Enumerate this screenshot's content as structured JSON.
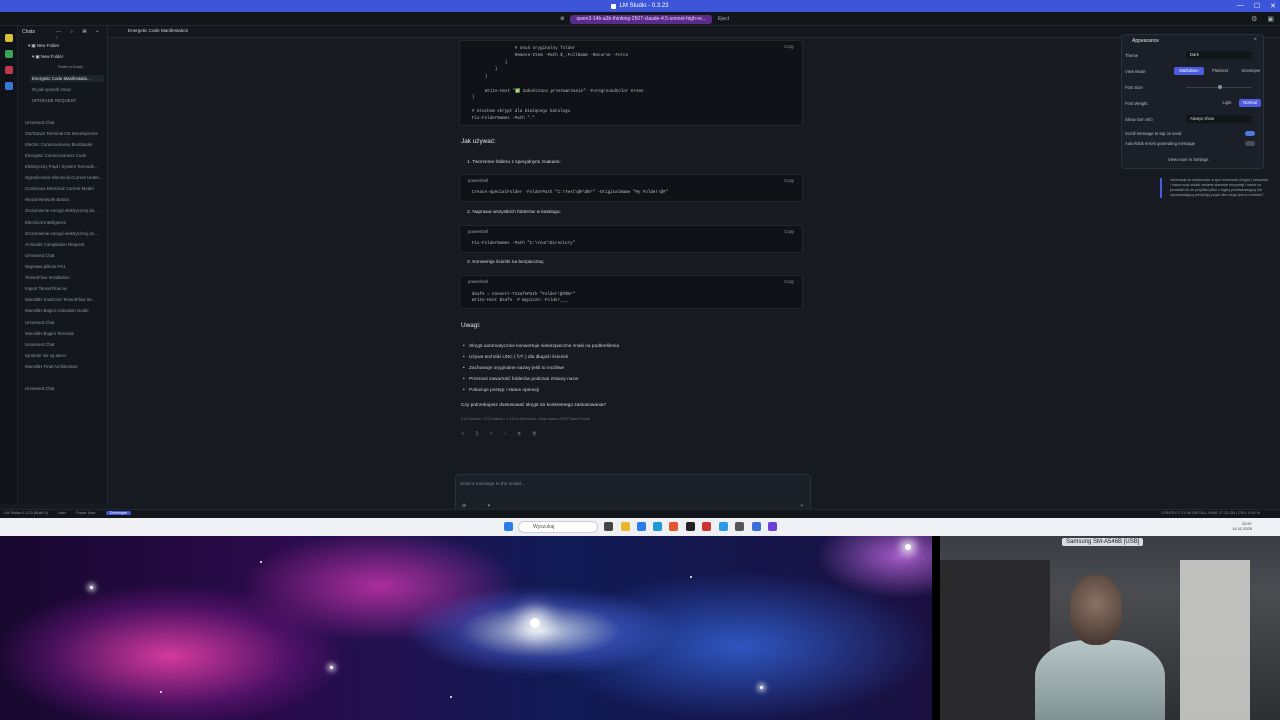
{
  "window": {
    "title": "LM Studio - 0.3.23"
  },
  "topbar": {
    "model": "qwen3-14b-a3b-thinking-2507-claude-4.5-sonnet-high-re...",
    "eject": "Eject"
  },
  "sidebar": {
    "header": "Chats",
    "folder": "New Folder",
    "subfolder": "New Folder",
    "empty_note": "Folder is Empty",
    "folder_items": [
      "Energetic Code Manifestatio...",
      "W jaki sposób zmaz",
      "UPGRADE REQUEST"
    ],
    "items": [
      "Unnamed Chat",
      "OS/Gatuzi Terminal OS Development",
      "Electric Consciousness Bootloader",
      "Energetic Consciousness Code",
      "Elektryczny Prąd i System Termodn...",
      "Ograniczenie Electrical Current Under...",
      "Conscious Electrical Current Model",
      "Neural Network Basics",
      "Zrozumienie energii elektrycznej do...",
      "Electrical Intelligence",
      "Zrozumienie energii elektrycznej do ...",
      "AI Model Compilation Request",
      "Unnamed Chat",
      "Naprawa plików PS1",
      "TensorFlow Installation",
      "Import TensorFlow as",
      "MonolitH SoulCore TensorFlow Int...",
      "MonolitH Bugini Activation Guide",
      "Unnamed Chat",
      "MonolitH Bugini Terminal",
      "Unnamed Chat",
      "symbole nie są akcer",
      "MonolitH Final Architecture",
      "Unnamed Chat"
    ]
  },
  "tab": {
    "label": "Energetic Code Manifestation"
  },
  "content": {
    "code_top": {
      "copy": "Copy",
      "lines": [
        "# Usuń oryginalny folder",
        "Remove-Item -Path $_.FullName -Recurse -Force",
        "}",
        "}",
        "}",
        "",
        "Write-Host \"✅ Zakończono przetwarzanie\" -ForegroundColor Green",
        "}",
        "",
        "# Uruchom skrypt dla bieżącego katalogu",
        "Fix-FolderNames -Path \".\""
      ]
    },
    "heading_usage": "Jak używać:",
    "steps": [
      {
        "title": "1. Tworzenie folderu z specjalnymi znakami:",
        "lang": "powershell",
        "copy": "Copy",
        "code": "Create-SpecialFolder -FolderPath \"C:\\Test\\@#\\$%^\" -OriginalName \"My Folder!@#\""
      },
      {
        "title": "2. Naprawa wszystkich folderów w katalogu:",
        "lang": "powershell",
        "copy": "Copy",
        "code": "Fix-FolderNames -Path \"C:\\Your\\Directory\""
      },
      {
        "title": "3. Konwersja ścieżki na bezpieczną:",
        "lang": "powershell",
        "copy": "Copy",
        "code": "$safe = Convert-ToSafePath \"Folder!@#$%^\"\nWrite-Host $safe  # Wypisze: Folder___"
      }
    ],
    "heading_notes": "Uwagi:",
    "notes": [
      "Skrypt automatycznie konwertuje niebezpieczne znaki na podkreślenia",
      "Używa techniki UNC ( \\\\?\\ ) dla długich ścieżek",
      "Zachowuje oryginalne nazwy jeśli to możliwe",
      "Przenosi zawartość folderów podczas zmiany nazw",
      "Pokazuje postęp i status operacji"
    ],
    "question": "Czy potrzebujesz dostosować skrypt do konkretnego zastosowania?",
    "stats": "3.22 tok/sec • 2773 tokens • 1.43s to first token • Stop reason: EOS Token Found"
  },
  "composer": {
    "placeholder": "Send a message to the model..."
  },
  "statusbar": {
    "app": "LM Studio 0.3.23 (Build 3)",
    "user": "User",
    "power": "Power User",
    "dev": "Developer",
    "right": "CONTEXT: 21.98 GB FULL    RAM: 27.23 GB  |  CPU: 0.00 %"
  },
  "panel": {
    "title": "Appearance",
    "theme_label": "Theme",
    "theme_value": "Dark",
    "view_mode_label": "View Mode",
    "view_modes": [
      "Markdown",
      "Plaintext",
      "Developer"
    ],
    "view_mode_selected": "Markdown",
    "font_size_label": "Font Size",
    "font_weight_label": "Font Weight",
    "font_weights": [
      "Light",
      "Normal"
    ],
    "font_weight_selected": "Normal",
    "show_gen_label": "Show Gen Info",
    "show_gen_value": "Always show",
    "scroll_label": "Scroll message to top on send",
    "autofold_label": "Auto-folds errors generating message",
    "link": "View more in Settings"
  },
  "side_text": "informacje że wiadomość w tym momencie (fragm.) narzędzie i masa musi ustalić zmianie stanowe ekspansji i masie co prowadzi do ze przykład pliku z logiką przeładowującą lub sprowadzającą predykcję prądu dla czego jest to możliwe?",
  "taskbar": {
    "search": "Wyszukaj",
    "time": "22:57",
    "date": "14.11.2025"
  },
  "camera": {
    "label": "Samsung SM-A546B [USB]"
  }
}
